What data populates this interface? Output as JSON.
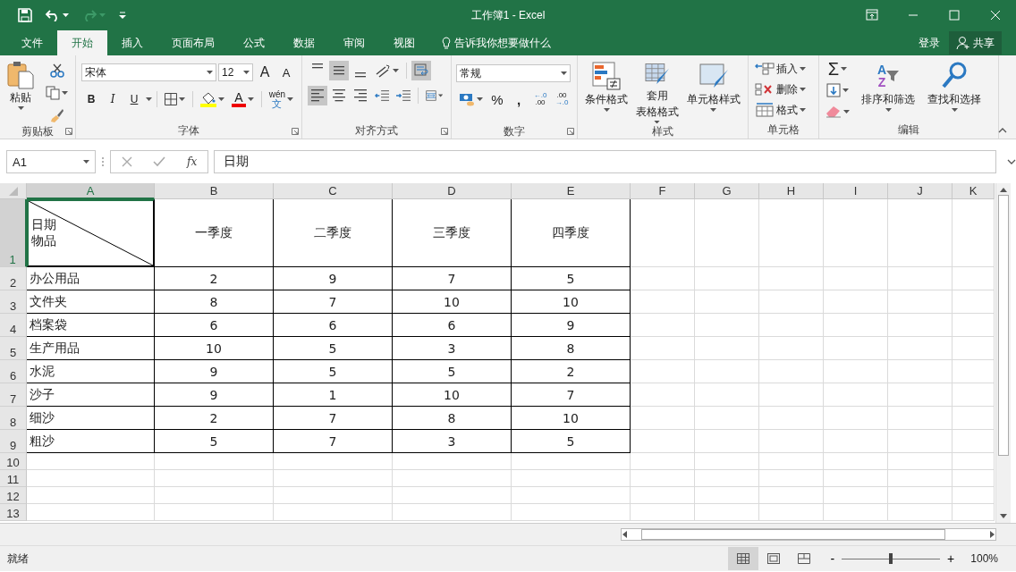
{
  "window": {
    "title": "工作簿1 - Excel"
  },
  "menu_tabs": [
    {
      "label": "文件",
      "selected": false
    },
    {
      "label": "开始",
      "selected": true
    },
    {
      "label": "插入",
      "selected": false
    },
    {
      "label": "页面布局",
      "selected": false
    },
    {
      "label": "公式",
      "selected": false
    },
    {
      "label": "数据",
      "selected": false
    },
    {
      "label": "审阅",
      "selected": false
    },
    {
      "label": "视图",
      "selected": false
    }
  ],
  "tell_me": {
    "placeholder": "告诉我你想要做什么"
  },
  "account": {
    "sign_in": "登录",
    "share": "共享"
  },
  "ribbon": {
    "clipboard": {
      "label": "剪贴板",
      "paste": "粘贴"
    },
    "font": {
      "label": "字体",
      "font_name": "宋体",
      "font_size": "12",
      "grow": "A",
      "shrink": "A",
      "bold": "B",
      "italic": "I",
      "underline": "U",
      "font_color": "A",
      "phonetic": [
        "wén",
        "文"
      ]
    },
    "alignment": {
      "label": "对齐方式",
      "vertical": [
        {
          "kind": "top",
          "selected": false
        },
        {
          "kind": "middle",
          "selected": true
        },
        {
          "kind": "bottom",
          "selected": false
        }
      ],
      "horizontal": [
        {
          "kind": "left",
          "selected": true
        },
        {
          "kind": "center",
          "selected": false
        },
        {
          "kind": "right",
          "selected": false
        }
      ],
      "wrap_text": {
        "selected": true
      }
    },
    "number": {
      "label": "数字",
      "format": "常规",
      "percent": "%",
      "comma": ",",
      "increase_decimal": [
        "←.0",
        ".00"
      ],
      "decrease_decimal": [
        ".00",
        "→.0"
      ]
    },
    "styles": {
      "label": "样式",
      "buttons": [
        {
          "kind": "conditional",
          "lines": [
            "条件格式"
          ]
        },
        {
          "kind": "table",
          "lines": [
            "套用",
            "表格格式"
          ]
        },
        {
          "kind": "cell",
          "lines": [
            "单元格样式"
          ]
        }
      ]
    },
    "cells": {
      "label": "单元格",
      "buttons": [
        {
          "kind": "insert",
          "label": "插入"
        },
        {
          "kind": "delete",
          "label": "删除"
        },
        {
          "kind": "format",
          "label": "格式"
        }
      ]
    },
    "editing": {
      "label": "编辑",
      "sum": "Σ",
      "sort_letters": [
        "A",
        "Z"
      ],
      "sort_filter": "排序和筛选",
      "find_select": "查找和选择"
    }
  },
  "formula_bar": {
    "name_box": "A1",
    "fx": "fx",
    "value": "日期"
  },
  "sheet": {
    "columns": [
      {
        "label": "A",
        "selected": true
      },
      {
        "label": "B",
        "selected": false
      },
      {
        "label": "C",
        "selected": false
      },
      {
        "label": "D",
        "selected": false
      },
      {
        "label": "E",
        "selected": false
      },
      {
        "label": "F",
        "selected": false
      },
      {
        "label": "G",
        "selected": false
      },
      {
        "label": "H",
        "selected": false
      },
      {
        "label": "I",
        "selected": false
      },
      {
        "label": "J",
        "selected": false
      },
      {
        "label": "K",
        "selected": false
      }
    ],
    "rows": [
      {
        "label": "1",
        "selected": true
      },
      {
        "label": "2",
        "selected": false
      },
      {
        "label": "3",
        "selected": false
      },
      {
        "label": "4",
        "selected": false
      },
      {
        "label": "5",
        "selected": false
      },
      {
        "label": "6",
        "selected": false
      },
      {
        "label": "7",
        "selected": false
      },
      {
        "label": "8",
        "selected": false
      },
      {
        "label": "9",
        "selected": false
      },
      {
        "label": "10",
        "selected": false
      },
      {
        "label": "11",
        "selected": false
      },
      {
        "label": "12",
        "selected": false
      },
      {
        "label": "13",
        "selected": false
      }
    ],
    "corner_cell": [
      "日期",
      "物品"
    ],
    "quarters": [
      "一季度",
      "二季度",
      "三季度",
      "四季度"
    ],
    "data": [
      {
        "item": "办公用品",
        "values": [
          "2",
          "9",
          "7",
          "5"
        ]
      },
      {
        "item": "文件夹",
        "values": [
          "8",
          "7",
          "10",
          "10"
        ]
      },
      {
        "item": "档案袋",
        "values": [
          "6",
          "6",
          "6",
          "9"
        ]
      },
      {
        "item": "生产用品",
        "values": [
          "10",
          "5",
          "3",
          "8"
        ]
      },
      {
        "item": "水泥",
        "values": [
          "9",
          "5",
          "5",
          "2"
        ]
      },
      {
        "item": "沙子",
        "values": [
          "9",
          "1",
          "10",
          "7"
        ]
      },
      {
        "item": "细沙",
        "values": [
          "2",
          "7",
          "8",
          "10"
        ]
      },
      {
        "item": "粗沙",
        "values": [
          "5",
          "7",
          "3",
          "5"
        ]
      }
    ]
  },
  "status_bar": {
    "status": "就绪",
    "views": [
      {
        "kind": "normal",
        "selected": true
      },
      {
        "kind": "page_layout",
        "selected": false
      },
      {
        "kind": "page_break",
        "selected": false
      }
    ],
    "minus": "-",
    "plus": "+",
    "zoom_slider": {
      "level": 0.5
    },
    "zoom": "100%"
  }
}
